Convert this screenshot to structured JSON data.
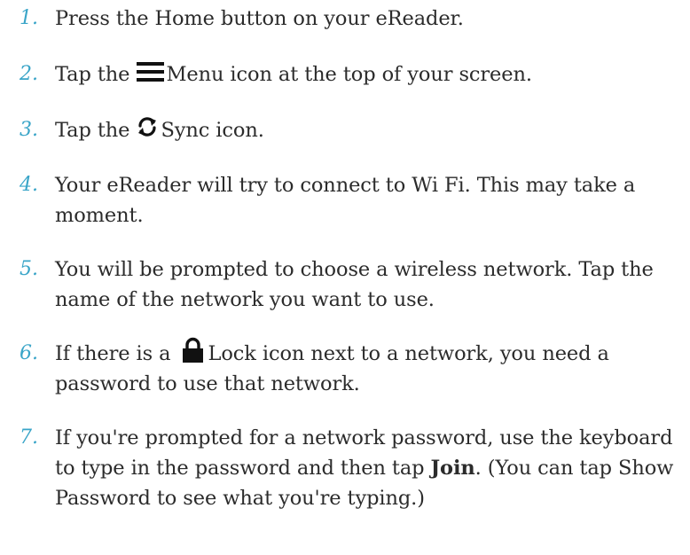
{
  "steps": [
    {
      "num": "1.",
      "parts": [
        "Press the Home button on your eReader."
      ]
    },
    {
      "num": "2.",
      "parts": [
        "Tap the ",
        "Menu icon at the top of your screen."
      ],
      "icon": "menu-icon"
    },
    {
      "num": "3.",
      "parts": [
        "Tap the ",
        "Sync icon."
      ],
      "icon": "sync-icon"
    },
    {
      "num": "4.",
      "parts": [
        "Your eReader will try to connect to Wi Fi. This may take a moment."
      ]
    },
    {
      "num": "5.",
      "parts": [
        "You will be prompted to choose a wireless network. Tap the name of the network you want to use."
      ]
    },
    {
      "num": "6.",
      "parts": [
        "If there is a ",
        "Lock icon next to a network, you need a password to use that network."
      ],
      "icon": "lock-icon"
    },
    {
      "num": "7.",
      "parts": [
        "If you're prompted for a network password, use the keyboard to type in the password and then tap ",
        "Join",
        ". (You can tap Show Password to see what you're typing.)"
      ]
    }
  ],
  "colors": {
    "number": "#3aa5c8",
    "text": "#2b2b2b"
  }
}
